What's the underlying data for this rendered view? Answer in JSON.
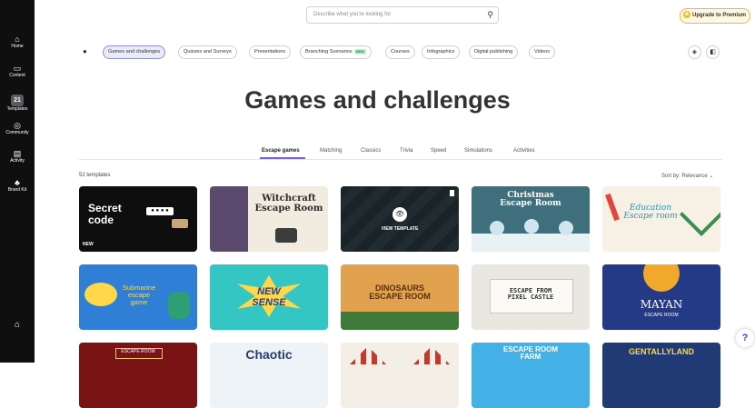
{
  "sidebar": {
    "items": [
      {
        "label": "Home",
        "icon": "home-icon",
        "glyph": "⌂"
      },
      {
        "label": "Content",
        "icon": "folder-icon",
        "glyph": "▭"
      },
      {
        "label": "Templates",
        "icon": "templates-icon",
        "glyph": "21"
      },
      {
        "label": "Community",
        "icon": "compass-icon",
        "glyph": "◎"
      },
      {
        "label": "Activity",
        "icon": "activity-icon",
        "glyph": "▤"
      },
      {
        "label": "Brand Kit",
        "icon": "brand-kit-icon",
        "glyph": "♣"
      }
    ],
    "active_index": 2,
    "bottom_icon": "house-icon",
    "bottom_glyph": "⌂"
  },
  "search": {
    "placeholder": "Describe what you're looking for",
    "icon": "search-icon",
    "glyph": "⚲"
  },
  "upgrade": {
    "label": "Upgrade to Premium",
    "icon": "star-icon",
    "glyph": "★",
    "color": "#f5b922"
  },
  "filters": {
    "person_glyph": "●",
    "chips": [
      {
        "label": "Games and challenges",
        "active": true
      },
      {
        "label": "Quizzes and Surveys"
      },
      {
        "label": "Presentations"
      },
      {
        "label": "Branching Scenarios",
        "badge": "NEW"
      },
      {
        "label": "Courses"
      },
      {
        "label": "Infographics"
      },
      {
        "label": "Digital publishing"
      },
      {
        "label": "Videos"
      }
    ],
    "right_icons": [
      {
        "name": "stack-icon",
        "glyph": "◈"
      },
      {
        "name": "note-icon",
        "glyph": "◧"
      }
    ]
  },
  "title": "Games and challenges",
  "subtabs": [
    "Escape games",
    "Matching",
    "Classics",
    "Trivia",
    "Speed",
    "Simulations",
    "Activities"
  ],
  "active_subtab": 0,
  "accent_color": "#7b5cf0",
  "templates_count": "52 templates",
  "sort_label": "Sort by: Relevance ⌄",
  "cards": [
    {
      "title": "Secret\ncode",
      "bg": "#0e0e0e",
      "color": "#ffffff",
      "new_label": "NEW"
    },
    {
      "title": "Witchcraft\nEscape Room",
      "bg": "#f1ebe0",
      "color": "#2b2b2b"
    },
    {
      "title": "",
      "bg": "#1f2a2e",
      "color": "#ffffff",
      "view_label": "VIEW TEMPLATE"
    },
    {
      "title": "Christmas\nEscape Room",
      "bg": "#3f6f7c",
      "color": "#ffffff"
    },
    {
      "title": "Education\nEscape room",
      "bg": "#f6f1e4",
      "color": "#2f8fb0"
    },
    {
      "title": "Submarine\nescape\ngame",
      "bg": "#2f7fd6",
      "color": "#ffd84a"
    },
    {
      "title": "NEW\nSENSE",
      "bg": "#34c6c3",
      "color": "#1a3aa8"
    },
    {
      "title": "DINOSAURS\nESCAPE ROOM",
      "bg": "#e0a24e",
      "color": "#5a2e0c"
    },
    {
      "title": "ESCAPE FROM\nPIXEL CASTLE",
      "bg": "#e9e7e0",
      "color": "#333333"
    },
    {
      "title": "MAYAN",
      "subtitle": "ESCAPE ROOM",
      "bg": "#243a86",
      "color": "#ffffff"
    },
    {
      "title": "ESCAPE ROOM",
      "bg": "#7a1414",
      "color": "#ffffff"
    },
    {
      "title": "Chaotic",
      "bg": "#eef3f7",
      "color": "#2a3b6b"
    },
    {
      "title": "",
      "bg": "#f3eee6",
      "color": "#333333"
    },
    {
      "title": "ESCAPE ROOM\nFARM",
      "bg": "#43b1e6",
      "color": "#ffffff"
    },
    {
      "title": "GENTALLYLAND",
      "bg": "#1f3a75",
      "color": "#ffd84a"
    }
  ],
  "help": {
    "glyph": "?"
  }
}
